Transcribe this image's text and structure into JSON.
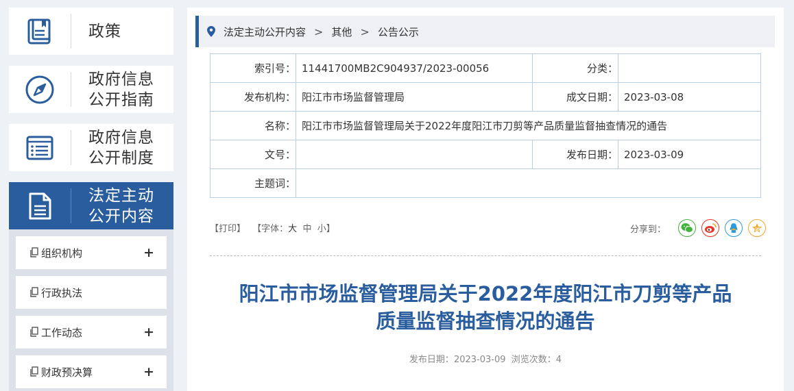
{
  "sidebar": {
    "big_items": [
      {
        "label": "政策",
        "icon": "book-icon"
      },
      {
        "label": "政府信息\n公开指南",
        "icon": "compass-icon"
      },
      {
        "label": "政府信息\n公开制度",
        "icon": "list-doc-icon"
      },
      {
        "label": "法定主动\n公开内容",
        "icon": "document-icon"
      }
    ],
    "sub_items": [
      {
        "label": "组织机构",
        "expand": "+"
      },
      {
        "label": "行政执法",
        "expand": ""
      },
      {
        "label": "工作动态",
        "expand": "+"
      },
      {
        "label": "财政预决算",
        "expand": "+"
      }
    ]
  },
  "breadcrumb": {
    "items": [
      "法定主动公开内容",
      "其他",
      "公告公示"
    ],
    "separator": ">"
  },
  "meta": {
    "index_label": "索引号：",
    "index_value": "11441700MB2C904937/2023-00056",
    "category_label": "分类：",
    "category_value": "",
    "publisher_label": "发布机构：",
    "publisher_value": "阳江市市场监督管理局",
    "created_label": "成文日期：",
    "created_value": "2023-03-08",
    "name_label": "名称：",
    "name_value": "阳江市市场监督管理局关于2022年度阳江市刀剪等产品质量监督抽查情况的通告",
    "docno_label": "文号：",
    "docno_value": "",
    "pubdate_label": "发布日期：",
    "pubdate_value": "2023-03-09",
    "keywords_label": "主题词：",
    "keywords_value": ""
  },
  "tools": {
    "print": "【打印】",
    "font_prefix": "【字体：",
    "large": "大",
    "medium": "中",
    "small": "小",
    "font_suffix": "】"
  },
  "share": {
    "label": "分享到：",
    "targets": [
      "wechat-icon",
      "weibo-icon",
      "qq-icon",
      "qzone-icon"
    ],
    "colors": {
      "wechat": "#3fb33a",
      "weibo": "#e6352b",
      "qq": "#2b9be0",
      "qzone": "#f5a623"
    }
  },
  "article": {
    "title_line1": "阳江市市场监督管理局关于2022年度阳江市刀剪等产品",
    "title_line2": "质量监督抽查情况的通告",
    "pub_label": "发布日期：",
    "pub_date": "2023-03-09",
    "views_label": "浏览次数：",
    "views": "4"
  },
  "colors": {
    "accent": "#2a5d9e",
    "border": "#b8cde6"
  }
}
